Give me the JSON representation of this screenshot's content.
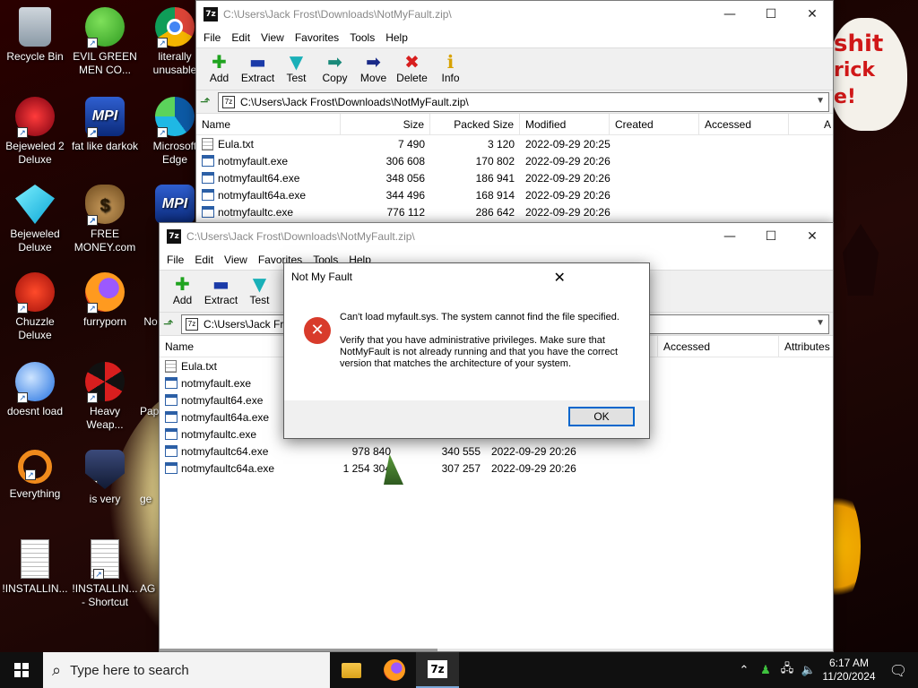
{
  "desktop": {
    "icons": [
      {
        "label": "Recycle Bin"
      },
      {
        "label": "EVIL GREEN MEN CO..."
      },
      {
        "label": "literally unusable"
      },
      {
        "label": "Bejeweled 2 Deluxe"
      },
      {
        "label": "fat like darkok"
      },
      {
        "label": "Microsoft Edge"
      },
      {
        "label": "Bejeweled Deluxe"
      },
      {
        "label": "FREE MONEY.com"
      },
      {
        "label": "Chuzzle Deluxe"
      },
      {
        "label": "furryporn"
      },
      {
        "label": "No"
      },
      {
        "label": "doesnt load"
      },
      {
        "label": "Heavy Weap..."
      },
      {
        "label": "Pap"
      },
      {
        "label": "Everything"
      },
      {
        "label": "is very"
      },
      {
        "label": "ge"
      },
      {
        "label": "!INSTALLIN..."
      },
      {
        "label": "!INSTALLIN... - Shortcut"
      },
      {
        "label": "AG"
      }
    ],
    "wallpaper_text": {
      "line1": "shit",
      "line2": "rick",
      "line3": "e!"
    }
  },
  "back_window": {
    "title": "C:\\Users\\Jack Frost\\Downloads\\NotMyFault.zip\\",
    "menu": [
      "File",
      "Edit",
      "View",
      "Favorites",
      "Tools",
      "Help"
    ],
    "toolbar": [
      "Add",
      "Extract",
      "Test",
      "Copy",
      "Move",
      "Delete",
      "Info"
    ],
    "address": "C:\\Users\\Jack Frost\\Downloads\\NotMyFault.zip\\",
    "columns": [
      "Name",
      "Size",
      "Packed Size",
      "Modified",
      "Created",
      "Accessed",
      "A"
    ],
    "rows": [
      {
        "name": "Eula.txt",
        "size": "7 490",
        "packed": "3 120",
        "modified": "2022-09-29 20:25"
      },
      {
        "name": "notmyfault.exe",
        "size": "306 608",
        "packed": "170 802",
        "modified": "2022-09-29 20:26"
      },
      {
        "name": "notmyfault64.exe",
        "size": "348 056",
        "packed": "186 941",
        "modified": "2022-09-29 20:26"
      },
      {
        "name": "notmyfault64a.exe",
        "size": "344 496",
        "packed": "168 914",
        "modified": "2022-09-29 20:26"
      },
      {
        "name": "notmyfaultc.exe",
        "size": "776 112",
        "packed": "286 642",
        "modified": "2022-09-29 20:26"
      }
    ]
  },
  "front_window": {
    "title": "C:\\Users\\Jack Frost\\Downloads\\NotMyFault.zip\\",
    "menu": [
      "File",
      "Edit",
      "View",
      "Favorites",
      "Tools",
      "Help"
    ],
    "toolbar": [
      "Add",
      "Extract",
      "Test"
    ],
    "address": "C:\\Users\\Jack Frost\\Downloads\\NotMyFault.zip\\",
    "columns": [
      "Name",
      "Accessed",
      "Attributes"
    ],
    "rows": [
      {
        "name": "Eula.txt",
        "size": "",
        "packed": "",
        "modified": ""
      },
      {
        "name": "notmyfault.exe",
        "size": "",
        "packed": "",
        "modified": ""
      },
      {
        "name": "notmyfault64.exe",
        "size": "",
        "packed": "",
        "modified": ""
      },
      {
        "name": "notmyfault64a.exe",
        "size": "",
        "packed": "",
        "modified": ""
      },
      {
        "name": "notmyfaultc.exe",
        "size": "",
        "packed": "",
        "modified": ""
      },
      {
        "name": "notmyfaultc64.exe",
        "size": "978 840",
        "packed": "340 555",
        "modified": "2022-09-29 20:26"
      },
      {
        "name": "notmyfaultc64a.exe",
        "size": "1 254 304",
        "packed": "307 257",
        "modified": "2022-09-29 20:26"
      }
    ]
  },
  "dialog": {
    "title": "Not My Fault",
    "message1": "Can't load myfault.sys. The system cannot find the file specified.",
    "message2": "Verify that you have administrative privileges. Make sure that NotMyFault is not already running and that you have the correct version that matches the architecture of your system.",
    "ok_label": "OK"
  },
  "taskbar": {
    "search_placeholder": "Type here to search",
    "time": "6:17 AM",
    "date": "11/20/2024"
  },
  "colors": {
    "accent": "#0066cc",
    "error": "#d83b2b",
    "taskbar": "#101010"
  }
}
